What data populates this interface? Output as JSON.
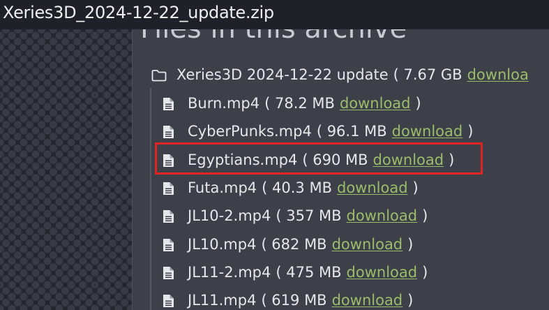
{
  "window": {
    "title": "Xeries3D_2024-12-22_update.zip"
  },
  "panel": {
    "heading": "Files in this archive"
  },
  "folder": {
    "name": "Xeries3D 2024-12-22 update",
    "size_prefix": "( 7.67 GB",
    "download_label": "downloa"
  },
  "files": [
    {
      "name": "Burn.mp4",
      "size": "( 78.2 MB",
      "link": "download",
      "close": ")"
    },
    {
      "name": "CyberPunks.mp4",
      "size": "( 96.1 MB",
      "link": "download",
      "close": ")"
    },
    {
      "name": "Egyptians.mp4",
      "size": "( 690 MB",
      "link": "download",
      "close": ")"
    },
    {
      "name": "Futa.mp4",
      "size": "( 40.3 MB",
      "link": "download",
      "close": ")"
    },
    {
      "name": "JL10-2.mp4",
      "size": "( 357 MB",
      "link": "download",
      "close": ")"
    },
    {
      "name": "JL10.mp4",
      "size": "( 682 MB",
      "link": "download",
      "close": ")"
    },
    {
      "name": "JL11-2.mp4",
      "size": "( 475 MB",
      "link": "download",
      "close": ")"
    },
    {
      "name": "JL11.mp4",
      "size": "( 619 MB",
      "link": "download",
      "close": ")"
    }
  ],
  "icons": {
    "folder": "folder-icon",
    "file": "file-text-icon"
  },
  "colors": {
    "link": "#9bbd6a",
    "highlight": "#e02424",
    "panel_background": "#3d4049",
    "text": "#e6e7ea"
  }
}
